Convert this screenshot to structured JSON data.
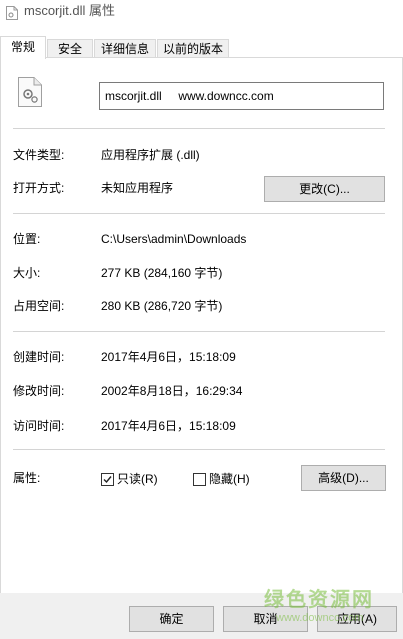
{
  "window": {
    "title": "mscorjit.dll 属性",
    "icon": "dll-file-icon"
  },
  "tabs": [
    {
      "label": "常规",
      "active": true
    },
    {
      "label": "安全",
      "active": false
    },
    {
      "label": "详细信息",
      "active": false
    },
    {
      "label": "以前的版本",
      "active": false
    }
  ],
  "general": {
    "file_name": "mscorjit.dll     www.downcc.com",
    "file_type_label": "文件类型:",
    "file_type_value": "应用程序扩展 (.dll)",
    "open_with_label": "打开方式:",
    "open_with_value": "未知应用程序",
    "change_button": "更改(C)...",
    "location_label": "位置:",
    "location_value": "C:\\Users\\admin\\Downloads",
    "size_label": "大小:",
    "size_value": "277 KB (284,160 字节)",
    "size_on_disk_label": "占用空间:",
    "size_on_disk_value": "280 KB (286,720 字节)",
    "created_label": "创建时间:",
    "created_value": "2017年4月6日，15:18:09",
    "modified_label": "修改时间:",
    "modified_value": "2002年8月18日，16:29:34",
    "accessed_label": "访问时间:",
    "accessed_value": "2017年4月6日，15:18:09",
    "attributes_label": "属性:",
    "readonly_label": "只读(R)",
    "readonly_checked": true,
    "hidden_label": "隐藏(H)",
    "hidden_checked": false,
    "advanced_button": "高级(D)..."
  },
  "footer": {
    "ok_button": "确定",
    "cancel_button": "取消",
    "apply_button": "应用(A)"
  },
  "watermark": {
    "text": "绿色资源网",
    "sub": "www.downcc.com"
  }
}
